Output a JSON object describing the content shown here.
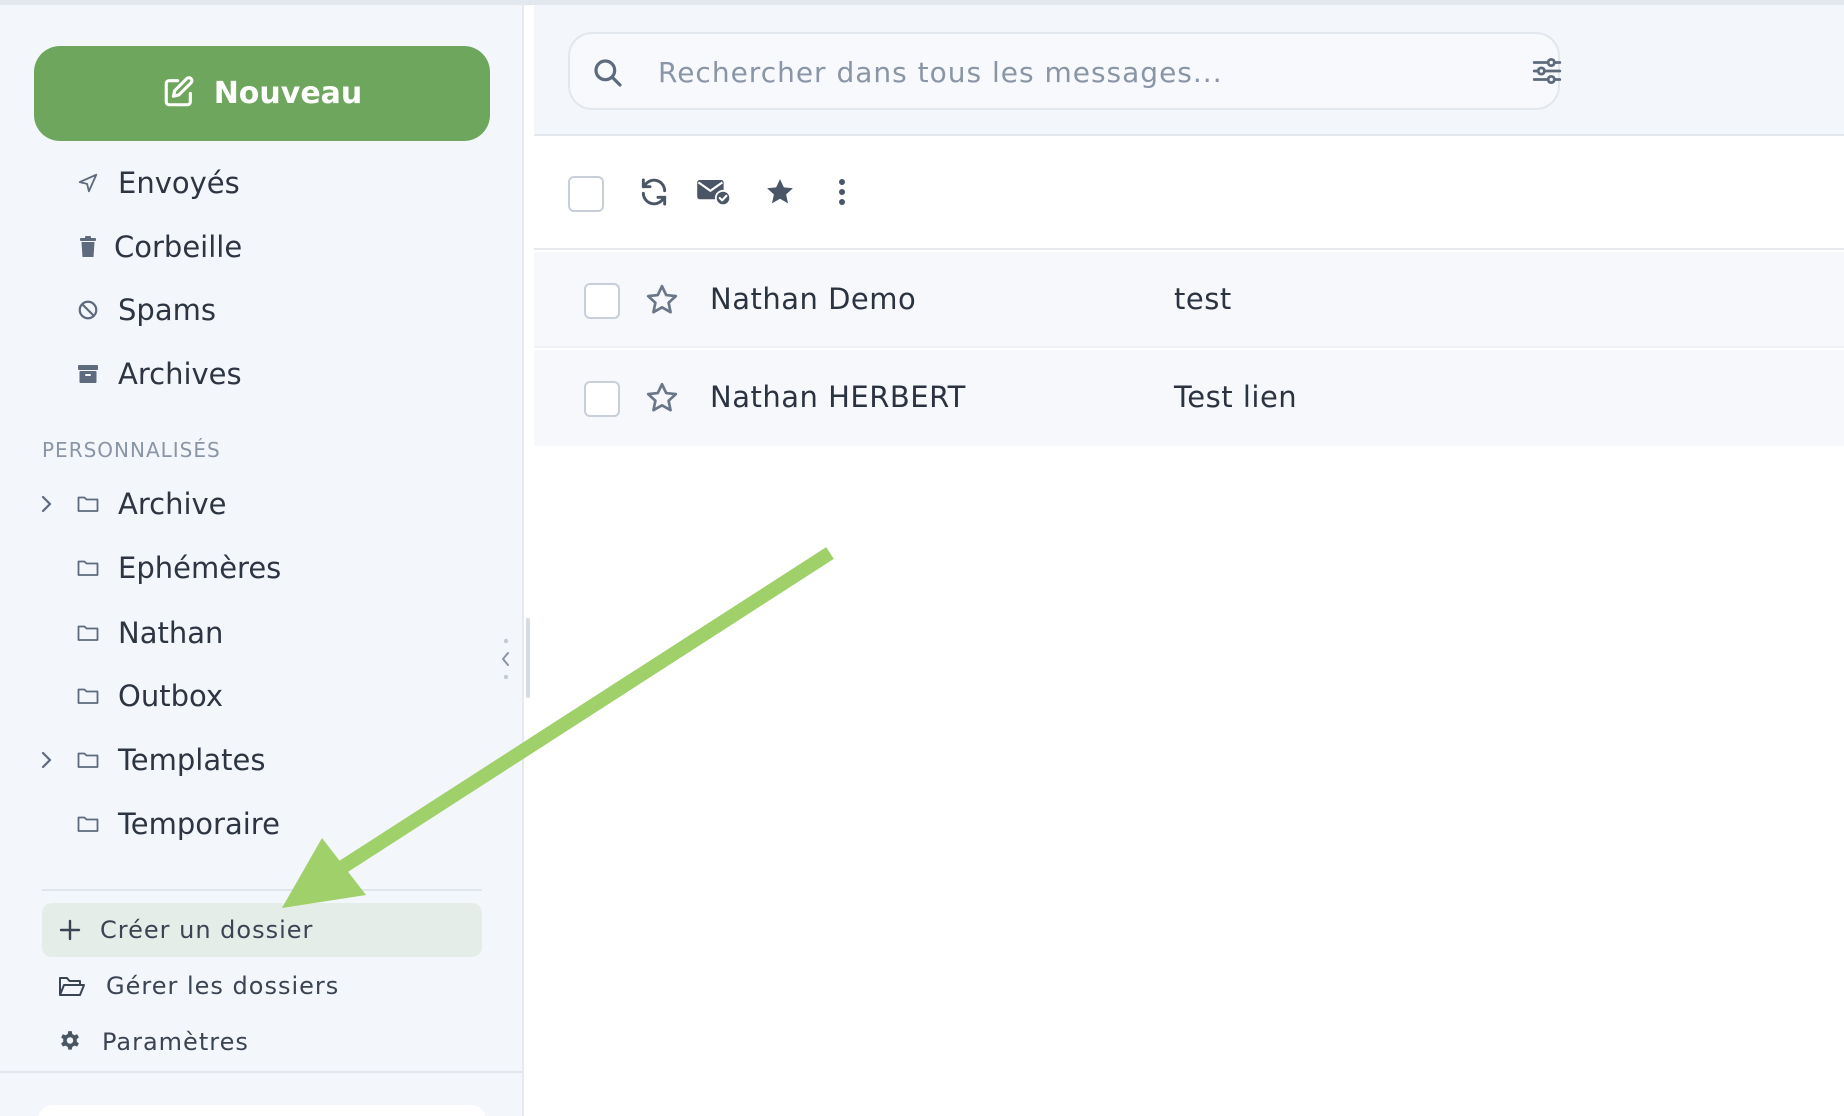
{
  "sidebar": {
    "new_button_label": "Nouveau",
    "folders": [
      {
        "label": "Envoyés",
        "icon": "send-icon"
      },
      {
        "label": "Corbeille",
        "icon": "trash-icon"
      },
      {
        "label": "Spams",
        "icon": "ban-icon"
      },
      {
        "label": "Archives",
        "icon": "archive-box-icon"
      }
    ],
    "custom_section_label": "PERSONNALISÉS",
    "custom_folders": [
      {
        "label": "Archive",
        "expandable": true
      },
      {
        "label": "Ephémères",
        "expandable": false
      },
      {
        "label": "Nathan",
        "expandable": false
      },
      {
        "label": "Outbox",
        "expandable": false
      },
      {
        "label": "Templates",
        "expandable": true
      },
      {
        "label": "Temporaire",
        "expandable": false
      }
    ],
    "actions": [
      {
        "label": "Créer un dossier",
        "icon": "plus-icon",
        "highlighted": true
      },
      {
        "label": "Gérer les dossiers",
        "icon": "folder-open-icon",
        "highlighted": false
      },
      {
        "label": "Paramètres",
        "icon": "gear-icon",
        "highlighted": false
      }
    ]
  },
  "search": {
    "placeholder": "Rechercher dans tous les messages..."
  },
  "toolbar": {
    "icons": [
      "select-all-checkbox",
      "refresh-icon",
      "mark-read-icon",
      "star-icon",
      "more-vertical-icon"
    ]
  },
  "messages": [
    {
      "sender": "Nathan Demo",
      "subject": "test",
      "starred": false
    },
    {
      "sender": "Nathan HERBERT",
      "subject": "Test lien",
      "starred": false
    }
  ],
  "colors": {
    "accent_green": "#6fa65e",
    "arrow_green": "#9fd06a",
    "sidebar_bg": "#f3f6fa",
    "icon_gray": "#5e6a7d"
  }
}
